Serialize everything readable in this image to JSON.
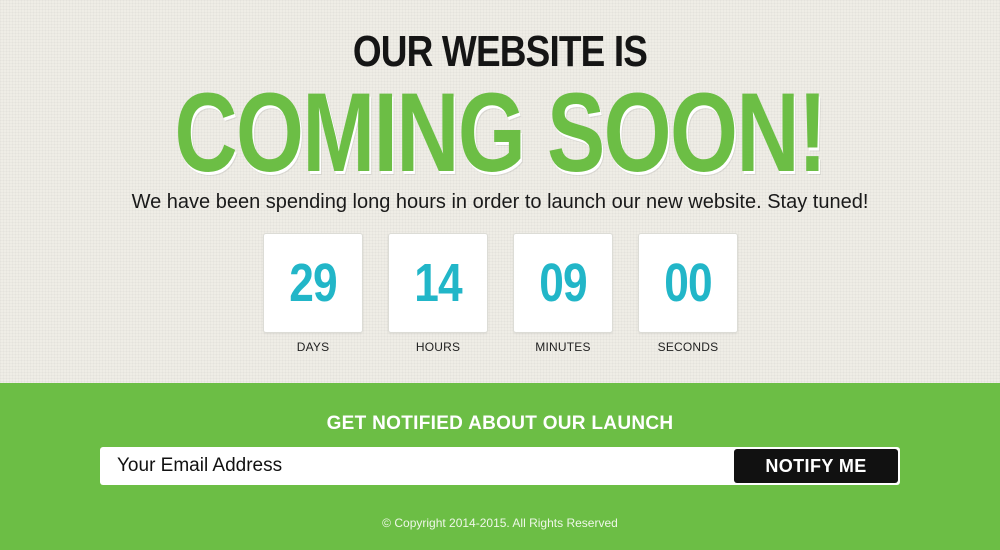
{
  "hero": {
    "headline_small": "OUR WEBSITE IS",
    "headline_big": "COMING SOON!",
    "tagline": "We have been spending long hours in order to launch our new website. Stay tuned!"
  },
  "countdown": {
    "days": {
      "value": "29",
      "label": "DAYS"
    },
    "hours": {
      "value": "14",
      "label": "HOURS"
    },
    "minutes": {
      "value": "09",
      "label": "MINUTES"
    },
    "seconds": {
      "value": "00",
      "label": "SECONDS"
    }
  },
  "signup": {
    "title": "GET NOTIFIED ABOUT OUR LAUNCH",
    "email_placeholder": "Your Email Address",
    "button_label": "NOTIFY ME"
  },
  "footer": {
    "copyright": "© Copyright 2014-2015. All Rights Reserved"
  },
  "colors": {
    "accent_green": "#6cbe45",
    "countdown_digits": "#22b6c8",
    "button_bg": "#111111",
    "page_bg": "#efede6"
  }
}
